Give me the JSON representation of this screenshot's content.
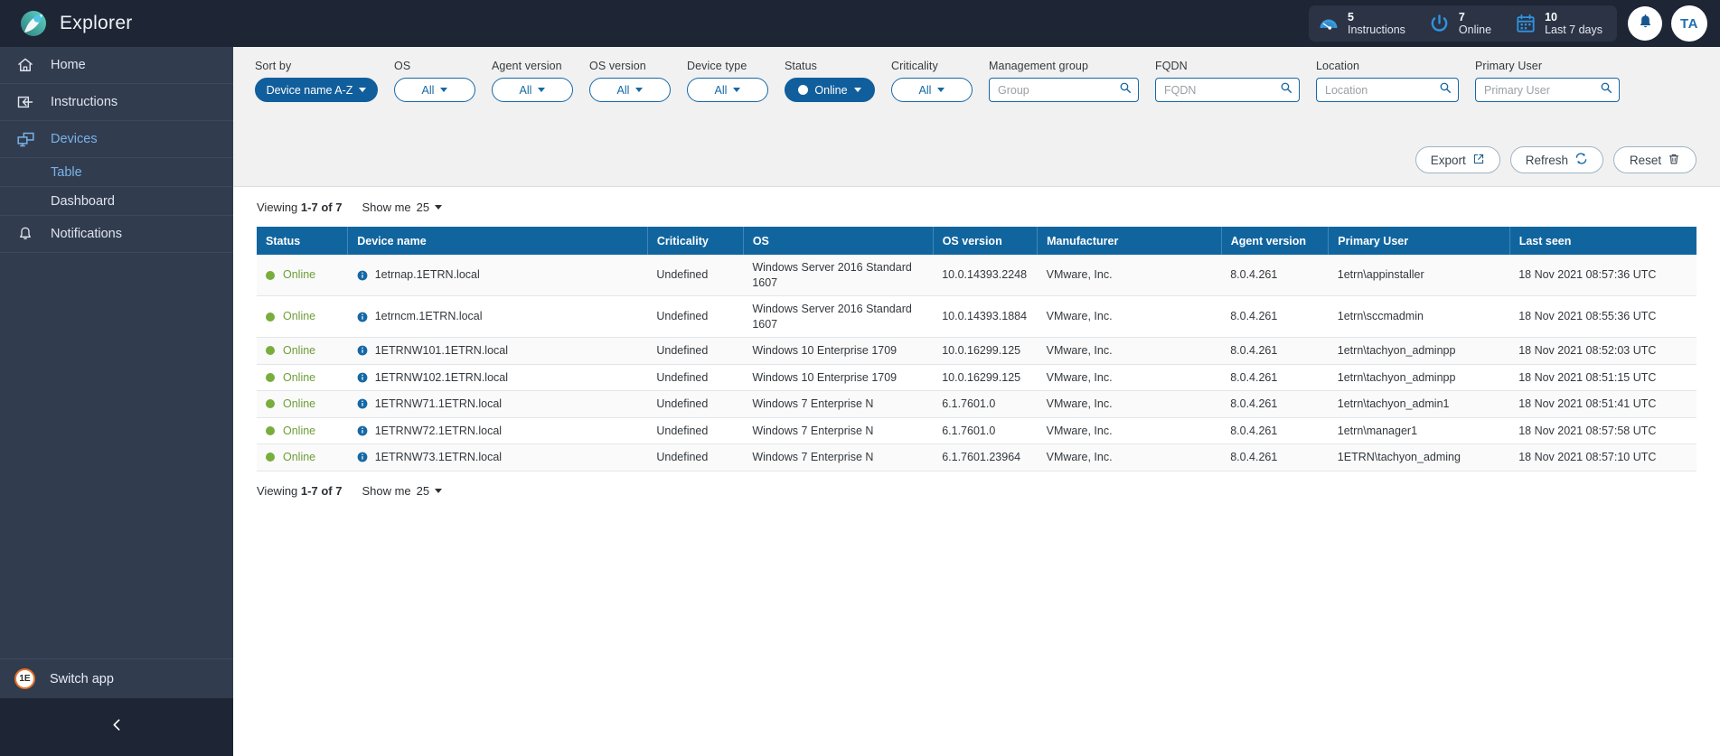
{
  "app": {
    "title": "Explorer",
    "logo_icon": "explorer-logo-icon",
    "accent_blue": "#11659f",
    "header_bg": "#1e2534",
    "sidebar_bg": "#323c4f",
    "status_green": "#79ad3c"
  },
  "header": {
    "stats": [
      {
        "icon": "gauge-icon",
        "number": "5",
        "label": "Instructions"
      },
      {
        "icon": "power-icon",
        "number": "7",
        "label": "Online"
      },
      {
        "icon": "calendar-icon",
        "number": "10",
        "label": "Last 7 days"
      }
    ],
    "notifications_icon": "bell-icon",
    "avatar_initials": "TA"
  },
  "sidebar": {
    "items": [
      {
        "label": "Home",
        "icon": "home-icon",
        "active": false
      },
      {
        "label": "Instructions",
        "icon": "instructions-icon",
        "active": false
      },
      {
        "label": "Devices",
        "icon": "devices-icon",
        "active": true
      },
      {
        "label": "Notifications",
        "icon": "bell-icon",
        "active": false
      }
    ],
    "sub_items": [
      {
        "label": "Table",
        "active": true
      },
      {
        "label": "Dashboard",
        "active": false
      }
    ],
    "switch_app": {
      "label": "Switch app",
      "icon": "one-e-logo-icon",
      "badge": "1E"
    },
    "collapse_icon": "chevron-left-icon"
  },
  "filters": [
    {
      "name": "sort-by",
      "label": "Sort by",
      "type": "pill",
      "value": "Device name A-Z",
      "selected": true
    },
    {
      "name": "os",
      "label": "OS",
      "type": "pill",
      "value": "All",
      "selected": false
    },
    {
      "name": "agent-version",
      "label": "Agent version",
      "type": "pill",
      "value": "All",
      "selected": false
    },
    {
      "name": "os-version",
      "label": "OS version",
      "type": "pill",
      "value": "All",
      "selected": false
    },
    {
      "name": "device-type",
      "label": "Device type",
      "type": "pill",
      "value": "All",
      "selected": false
    },
    {
      "name": "status",
      "label": "Status",
      "type": "pill",
      "value": "Online",
      "selected": true
    },
    {
      "name": "criticality",
      "label": "Criticality",
      "type": "pill",
      "value": "All",
      "selected": false
    },
    {
      "name": "management-group",
      "label": "Management group",
      "type": "search",
      "value": "",
      "placeholder": "Group"
    },
    {
      "name": "fqdn",
      "label": "FQDN",
      "type": "search",
      "value": "",
      "placeholder": "FQDN"
    },
    {
      "name": "location",
      "label": "Location",
      "type": "search",
      "value": "",
      "placeholder": "Location"
    },
    {
      "name": "primary-user",
      "label": "Primary User",
      "type": "search",
      "value": "",
      "placeholder": "Primary User"
    }
  ],
  "actions": [
    {
      "label": "Export",
      "icon": "external-link-icon"
    },
    {
      "label": "Refresh",
      "icon": "sync-icon"
    },
    {
      "label": "Reset",
      "icon": "trash-icon"
    }
  ],
  "pagination": {
    "viewing_prefix": "Viewing",
    "viewing_range": "1-7 of 7",
    "show_me_label": "Show me",
    "show_me_value": "25"
  },
  "table": {
    "columns": [
      "Status",
      "Device name",
      "Criticality",
      "OS",
      "OS version",
      "Manufacturer",
      "Agent version",
      "Primary User",
      "Last seen"
    ],
    "rows": [
      {
        "status": "Online",
        "device_name": "1etrnap.1ETRN.local",
        "criticality": "Undefined",
        "os": "Windows Server 2016 Standard 1607",
        "os_version": "10.0.14393.2248",
        "manufacturer": "VMware, Inc.",
        "agent_version": "8.0.4.261",
        "primary_user": "1etrn\\appinstaller",
        "last_seen": "18 Nov 2021 08:57:36 UTC"
      },
      {
        "status": "Online",
        "device_name": "1etrncm.1ETRN.local",
        "criticality": "Undefined",
        "os": "Windows Server 2016 Standard 1607",
        "os_version": "10.0.14393.1884",
        "manufacturer": "VMware, Inc.",
        "agent_version": "8.0.4.261",
        "primary_user": "1etrn\\sccmadmin",
        "last_seen": "18 Nov 2021 08:55:36 UTC"
      },
      {
        "status": "Online",
        "device_name": "1ETRNW101.1ETRN.local",
        "criticality": "Undefined",
        "os": "Windows 10 Enterprise 1709",
        "os_version": "10.0.16299.125",
        "manufacturer": "VMware, Inc.",
        "agent_version": "8.0.4.261",
        "primary_user": "1etrn\\tachyon_adminpp",
        "last_seen": "18 Nov 2021 08:52:03 UTC"
      },
      {
        "status": "Online",
        "device_name": "1ETRNW102.1ETRN.local",
        "criticality": "Undefined",
        "os": "Windows 10 Enterprise 1709",
        "os_version": "10.0.16299.125",
        "manufacturer": "VMware, Inc.",
        "agent_version": "8.0.4.261",
        "primary_user": "1etrn\\tachyon_adminpp",
        "last_seen": "18 Nov 2021 08:51:15 UTC"
      },
      {
        "status": "Online",
        "device_name": "1ETRNW71.1ETRN.local",
        "criticality": "Undefined",
        "os": "Windows 7 Enterprise N",
        "os_version": "6.1.7601.0",
        "manufacturer": "VMware, Inc.",
        "agent_version": "8.0.4.261",
        "primary_user": "1etrn\\tachyon_admin1",
        "last_seen": "18 Nov 2021 08:51:41 UTC"
      },
      {
        "status": "Online",
        "device_name": "1ETRNW72.1ETRN.local",
        "criticality": "Undefined",
        "os": "Windows 7 Enterprise N",
        "os_version": "6.1.7601.0",
        "manufacturer": "VMware, Inc.",
        "agent_version": "8.0.4.261",
        "primary_user": "1etrn\\manager1",
        "last_seen": "18 Nov 2021 08:57:58 UTC"
      },
      {
        "status": "Online",
        "device_name": "1ETRNW73.1ETRN.local",
        "criticality": "Undefined",
        "os": "Windows 7 Enterprise N",
        "os_version": "6.1.7601.23964",
        "manufacturer": "VMware, Inc.",
        "agent_version": "8.0.4.261",
        "primary_user": "1ETRN\\tachyon_adming",
        "last_seen": "18 Nov 2021 08:57:10 UTC"
      }
    ]
  }
}
